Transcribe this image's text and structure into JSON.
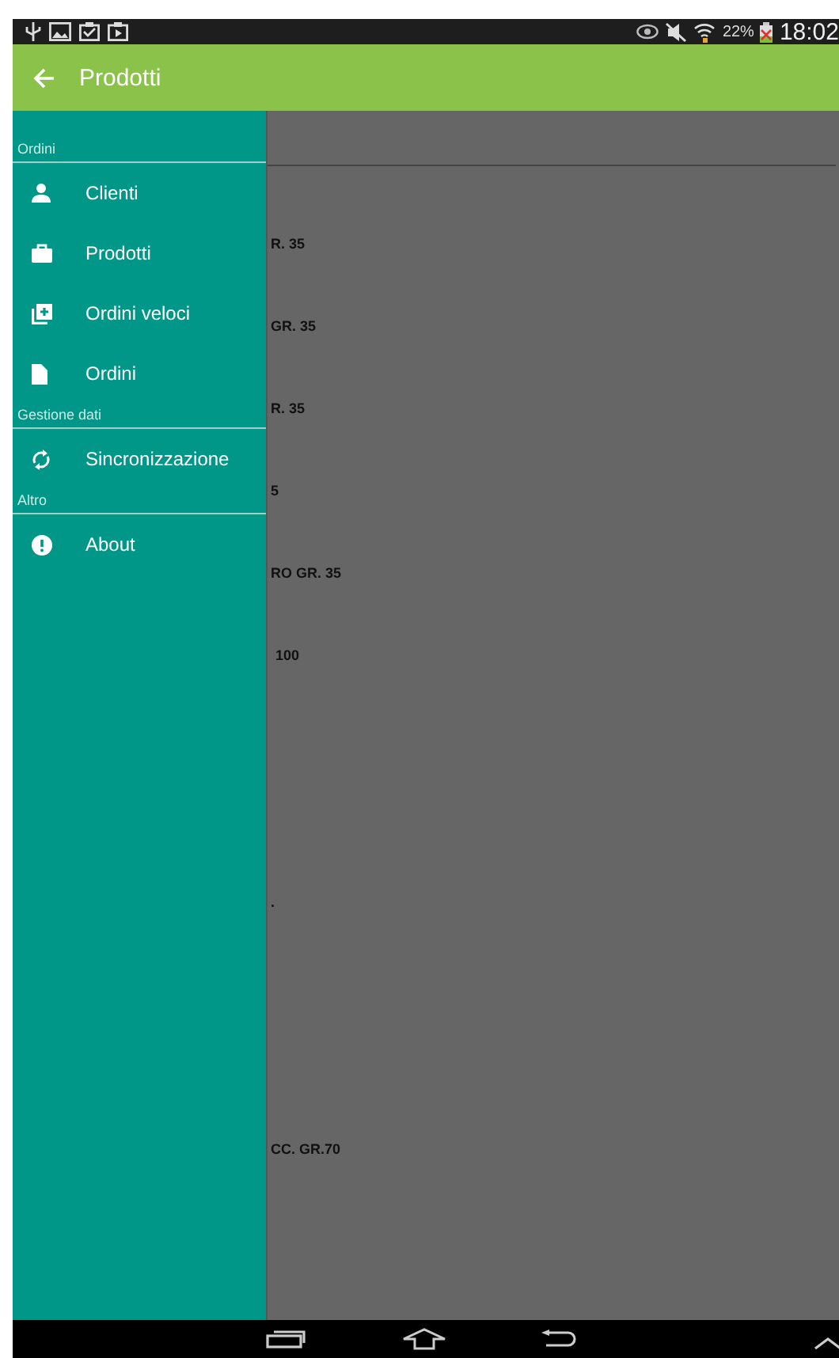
{
  "status_bar": {
    "battery_percent": "22%",
    "time": "18:02"
  },
  "app_bar": {
    "title": "Prodotti"
  },
  "drawer": {
    "sections": [
      {
        "header": "Ordini",
        "items": [
          {
            "label": "Clienti"
          },
          {
            "label": "Prodotti"
          },
          {
            "label": "Ordini veloci"
          },
          {
            "label": "Ordini"
          }
        ]
      },
      {
        "header": "Gestione dati",
        "items": [
          {
            "label": "Sincronizzazione"
          }
        ]
      },
      {
        "header": "Altro",
        "items": [
          {
            "label": "About"
          }
        ]
      }
    ]
  },
  "product_list": [
    {
      "text": "R. 35"
    },
    {
      "text": "GR. 35"
    },
    {
      "text": "R. 35"
    },
    {
      "text": "5"
    },
    {
      "text": "RO GR. 35"
    },
    {
      "text": "100"
    },
    {
      "text": "."
    },
    {
      "text": "CC. GR.70"
    }
  ]
}
